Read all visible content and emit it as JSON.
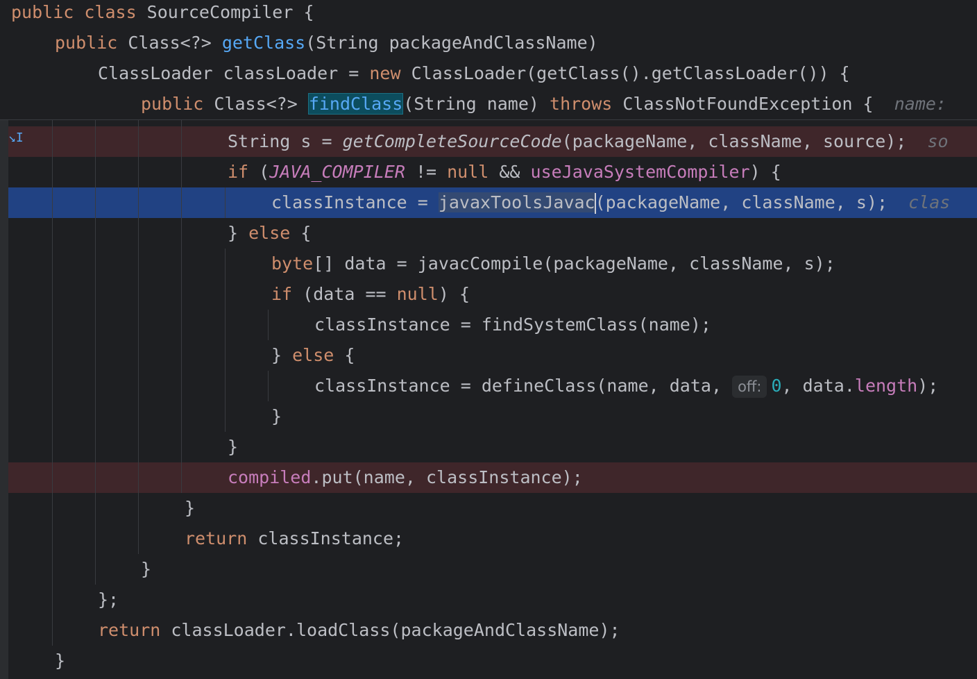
{
  "editor": {
    "sticky_lines": [
      {
        "tokens": [
          {
            "t": "public ",
            "c": "kw"
          },
          {
            "t": "class ",
            "c": "kw"
          },
          {
            "t": "SourceCompiler {",
            "c": ""
          }
        ]
      },
      {
        "tokens": [
          {
            "t": "public ",
            "c": "kw"
          },
          {
            "t": "Class<?> ",
            "c": ""
          },
          {
            "t": "getClass",
            "c": "fn"
          },
          {
            "t": "(String packageAndClassName)",
            "c": ""
          }
        ]
      },
      {
        "tokens": [
          {
            "t": "ClassLoader classLoader = ",
            "c": ""
          },
          {
            "t": "new ",
            "c": "kw"
          },
          {
            "t": "ClassLoader(getClass().getClassLoader()) {",
            "c": ""
          }
        ]
      },
      {
        "tokens": [
          {
            "t": "public ",
            "c": "kw"
          },
          {
            "t": "Class<?> ",
            "c": ""
          },
          {
            "t": "findClass",
            "c": "fn hl-def"
          },
          {
            "t": "(String name) ",
            "c": ""
          },
          {
            "t": "throws ",
            "c": "kw"
          },
          {
            "t": "ClassNotFoundException {  ",
            "c": ""
          },
          {
            "t": "name:",
            "c": "hint"
          }
        ]
      }
    ],
    "lines": [
      {
        "tokens": [
          {
            "t": "String s = ",
            "c": ""
          },
          {
            "t": "getCompleteSourceCode",
            "c": "it"
          },
          {
            "t": "(packageName, className, source);  ",
            "c": ""
          },
          {
            "t": "so",
            "c": "hint"
          }
        ]
      },
      {
        "tokens": [
          {
            "t": "if ",
            "c": "kw"
          },
          {
            "t": "(",
            "c": ""
          },
          {
            "t": "JAVA_COMPILER",
            "c": "cst"
          },
          {
            "t": " != ",
            "c": ""
          },
          {
            "t": "null",
            "c": "kw"
          },
          {
            "t": " && ",
            "c": ""
          },
          {
            "t": "useJavaSystemCompiler",
            "c": "fld"
          },
          {
            "t": ") {",
            "c": ""
          }
        ]
      },
      {
        "tokens": [
          {
            "t": "classInstance = ",
            "c": ""
          },
          {
            "t": "javaxToolsJavac",
            "c": "usage-hl"
          },
          {
            "t": "|",
            "c": "caret"
          },
          {
            "t": "(packageName, className, s);  ",
            "c": ""
          },
          {
            "t": "clas",
            "c": "hint"
          }
        ]
      },
      {
        "tokens": [
          {
            "t": "} ",
            "c": ""
          },
          {
            "t": "else",
            "c": "kw"
          },
          {
            "t": " {",
            "c": ""
          }
        ]
      },
      {
        "tokens": [
          {
            "t": "byte",
            "c": "kw"
          },
          {
            "t": "[] data = javacCompile(packageName, className, s);",
            "c": ""
          }
        ]
      },
      {
        "tokens": [
          {
            "t": "if ",
            "c": "kw"
          },
          {
            "t": "(data == ",
            "c": ""
          },
          {
            "t": "null",
            "c": "kw"
          },
          {
            "t": ") {",
            "c": ""
          }
        ]
      },
      {
        "tokens": [
          {
            "t": "classInstance = findSystemClass(name);",
            "c": ""
          }
        ]
      },
      {
        "tokens": [
          {
            "t": "} ",
            "c": ""
          },
          {
            "t": "else",
            "c": "kw"
          },
          {
            "t": " {",
            "c": ""
          }
        ]
      },
      {
        "tokens": [
          {
            "t": "classInstance = defineClass(name, data, ",
            "c": ""
          },
          {
            "t": "off:",
            "c": "inlay"
          },
          {
            "t": "0",
            "c": "num"
          },
          {
            "t": ", data.",
            "c": ""
          },
          {
            "t": "length",
            "c": "fld"
          },
          {
            "t": ");",
            "c": ""
          }
        ]
      },
      {
        "tokens": [
          {
            "t": "}",
            "c": ""
          }
        ]
      },
      {
        "tokens": [
          {
            "t": "}",
            "c": ""
          }
        ]
      },
      {
        "tokens": [
          {
            "t": "compiled",
            "c": "fld"
          },
          {
            "t": ".put(name, classInstance);",
            "c": ""
          }
        ]
      },
      {
        "tokens": [
          {
            "t": "}",
            "c": ""
          }
        ]
      },
      {
        "tokens": [
          {
            "t": "return ",
            "c": "kw"
          },
          {
            "t": "classInstance;",
            "c": ""
          }
        ]
      },
      {
        "tokens": [
          {
            "t": "}",
            "c": ""
          }
        ]
      },
      {
        "tokens": [
          {
            "t": "};",
            "c": ""
          }
        ]
      },
      {
        "tokens": [
          {
            "t": "return ",
            "c": "kw"
          },
          {
            "t": "classLoader.loadClass(packageAndClassName);",
            "c": ""
          }
        ]
      },
      {
        "tokens": [
          {
            "t": "}",
            "c": ""
          }
        ]
      }
    ]
  },
  "gutter": {
    "marker_icon": "step-into-icon",
    "marker_glyph": "↘I"
  },
  "colors": {
    "background": "#1e1f22",
    "breakpoint_line": "#3f262a",
    "selected_line": "#214283",
    "keyword": "#cf8e6d",
    "function": "#56a8f5",
    "field": "#c77dbb",
    "number": "#2aacb8"
  }
}
